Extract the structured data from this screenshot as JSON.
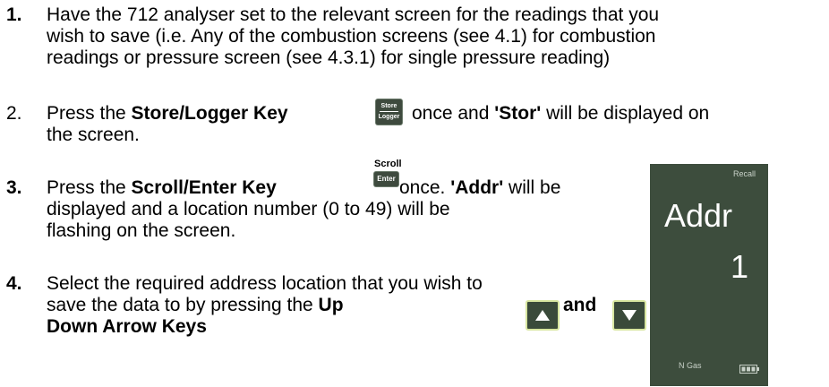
{
  "steps": [
    {
      "number": "1.",
      "lines": [
        "Have the 712 analyser set to the relevant screen for the readings that you",
        "wish to save (i.e. Any of the combustion screens (see 4.1) for combustion",
        "readings or pressure screen (see 4.3.1) for single pressure reading)"
      ]
    },
    {
      "number": "2.",
      "pre": "Press the ",
      "key_name": "Store/Logger Key",
      "mid": " once and ",
      "display_word": "'Stor'",
      "post": " will be displayed on",
      "line2": "the screen."
    },
    {
      "number": "3.",
      "pre": "Press the ",
      "key_name": "Scroll/Enter Key",
      "mid": "once. ",
      "display_word": "'Addr'",
      "post": " will be",
      "line2": "displayed and a location number (0 to 49) will be",
      "line3": "flashing on the screen."
    },
    {
      "number": "4.",
      "line1": "Select the required address location that you wish to",
      "line2_pre": "save the data to by pressing the ",
      "up_word": "Up",
      "and_word": "and",
      "line3": "Down Arrow Keys"
    }
  ],
  "keys": {
    "store_top": "Store",
    "store_bottom": "Logger",
    "scroll_label": "Scroll",
    "enter_label": "Enter",
    "up_icon": "up-arrow-icon",
    "down_icon": "down-arrow-icon"
  },
  "display": {
    "header": "Recall",
    "title": "Addr",
    "location": "1",
    "gas": "N  Gas",
    "battery_icon": "battery-icon"
  },
  "colors": {
    "key_bg": "#3e4a3e",
    "arrow_border": "#d8e6a0",
    "display_bg": "#3d4d3d"
  }
}
